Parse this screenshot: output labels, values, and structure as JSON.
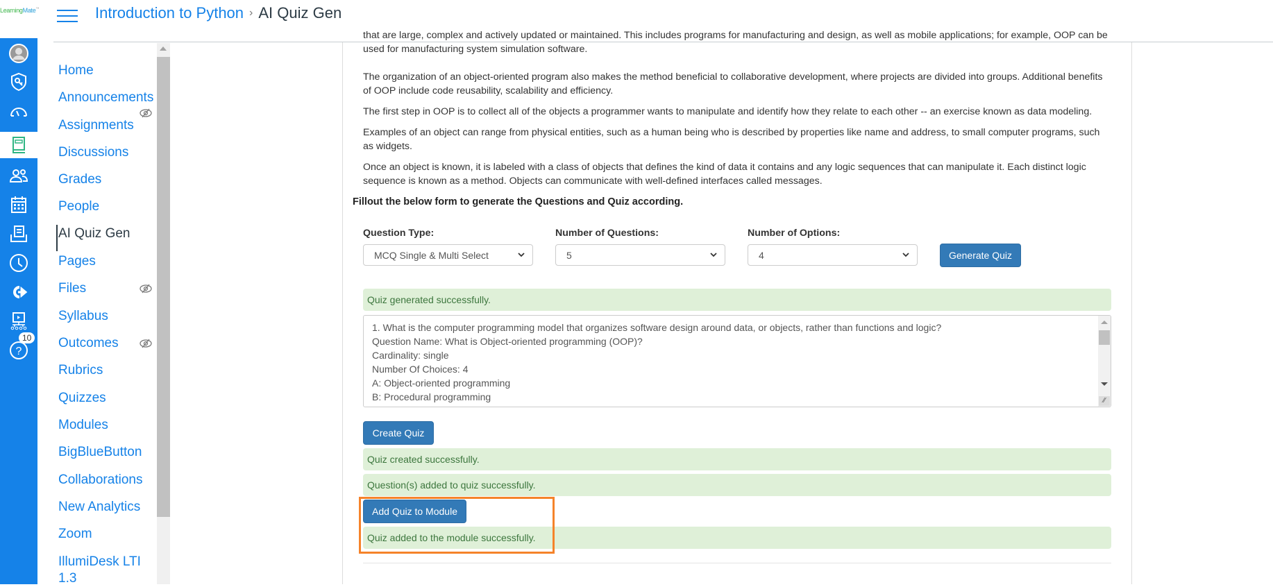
{
  "logo": {
    "text_a": "Learning",
    "text_b": "Mate",
    "tm": "™"
  },
  "global_nav": {
    "items": [
      {
        "name": "account",
        "icon": "avatar-icon"
      },
      {
        "name": "admin",
        "icon": "shield-key-icon"
      },
      {
        "name": "dashboard",
        "icon": "speedometer-icon"
      },
      {
        "name": "courses",
        "icon": "book-icon",
        "active": true
      },
      {
        "name": "groups",
        "icon": "people-icon"
      },
      {
        "name": "calendar",
        "icon": "calendar-icon"
      },
      {
        "name": "inbox",
        "icon": "inbox-icon"
      },
      {
        "name": "history",
        "icon": "clock-icon"
      },
      {
        "name": "commons",
        "icon": "share-arrow-icon"
      },
      {
        "name": "studio",
        "icon": "video-network-icon"
      },
      {
        "name": "help",
        "icon": "help-icon",
        "badge": "10"
      }
    ]
  },
  "header": {
    "breadcrumb": {
      "course": "Introduction to Python",
      "separator": "›",
      "current": "AI Quiz Gen"
    }
  },
  "course_nav": {
    "items": [
      {
        "label": "Home"
      },
      {
        "label": "Announcements"
      },
      {
        "label": "Assignments",
        "hidden": true
      },
      {
        "label": "Discussions"
      },
      {
        "label": "Grades"
      },
      {
        "label": "People"
      },
      {
        "label": "AI Quiz Gen",
        "active": true
      },
      {
        "label": "Pages"
      },
      {
        "label": "Files",
        "hidden": true
      },
      {
        "label": "Syllabus"
      },
      {
        "label": "Outcomes",
        "hidden": true
      },
      {
        "label": "Rubrics"
      },
      {
        "label": "Quizzes"
      },
      {
        "label": "Modules"
      },
      {
        "label": "BigBlueButton"
      },
      {
        "label": "Collaborations"
      },
      {
        "label": "New Analytics"
      },
      {
        "label": "Zoom"
      },
      {
        "label": "IllumiDesk LTI",
        "label2": "1.3"
      }
    ]
  },
  "content": {
    "paragraphs": [
      "that are large, complex and actively updated or maintained. This includes programs for manufacturing and design, as well as mobile applications; for example, OOP can be used for manufacturing system simulation software.",
      "The organization of an object-oriented program also makes the method beneficial to collaborative development, where projects are divided into groups. Additional benefits of OOP include code reusability, scalability and efficiency.",
      "The first step in OOP is to collect all of the objects a programmer wants to manipulate and identify how they relate to each other -- an exercise known as data modeling.",
      "Examples of an object can range from physical entities, such as a human being who is described by properties like name and address, to small computer programs, such as widgets.",
      "Once an object is known, it is labeled with a class of objects that defines the kind of data it contains and any logic sequences that can manipulate it. Each distinct logic sequence is known as a method. Objects can communicate with well-defined interfaces called messages."
    ],
    "form_intro": "Fillout the below form to generate the Questions and Quiz according."
  },
  "form": {
    "question_type": {
      "label": "Question Type:",
      "value": "MCQ Single & Multi Select"
    },
    "num_questions": {
      "label": "Number of Questions:",
      "value": "5"
    },
    "num_options": {
      "label": "Number of Options:",
      "value": "4"
    },
    "generate_label": "Generate Quiz"
  },
  "results": {
    "generated_msg": "Quiz generated successfully.",
    "output_lines": "1. What is the computer programming model that organizes software design around data, or objects, rather than functions and logic?\nQuestion Name: What is Object-oriented programming (OOP)?\nCardinality: single\nNumber Of Choices: 4\nA: Object-oriented programming\nB: Procedural programming\nC: Functional programming",
    "create_label": "Create Quiz",
    "created_msg": "Quiz created successfully.",
    "questions_added_msg": "Question(s) added to quiz successfully.",
    "add_module_label": "Add Quiz to Module",
    "module_added_msg": "Quiz added to the module successfully."
  },
  "colors": {
    "brand_blue": "#1582e8",
    "button_blue": "#337ab7",
    "success_bg": "#dff0d8",
    "success_text": "#3c763d",
    "highlight": "#f5832a"
  }
}
